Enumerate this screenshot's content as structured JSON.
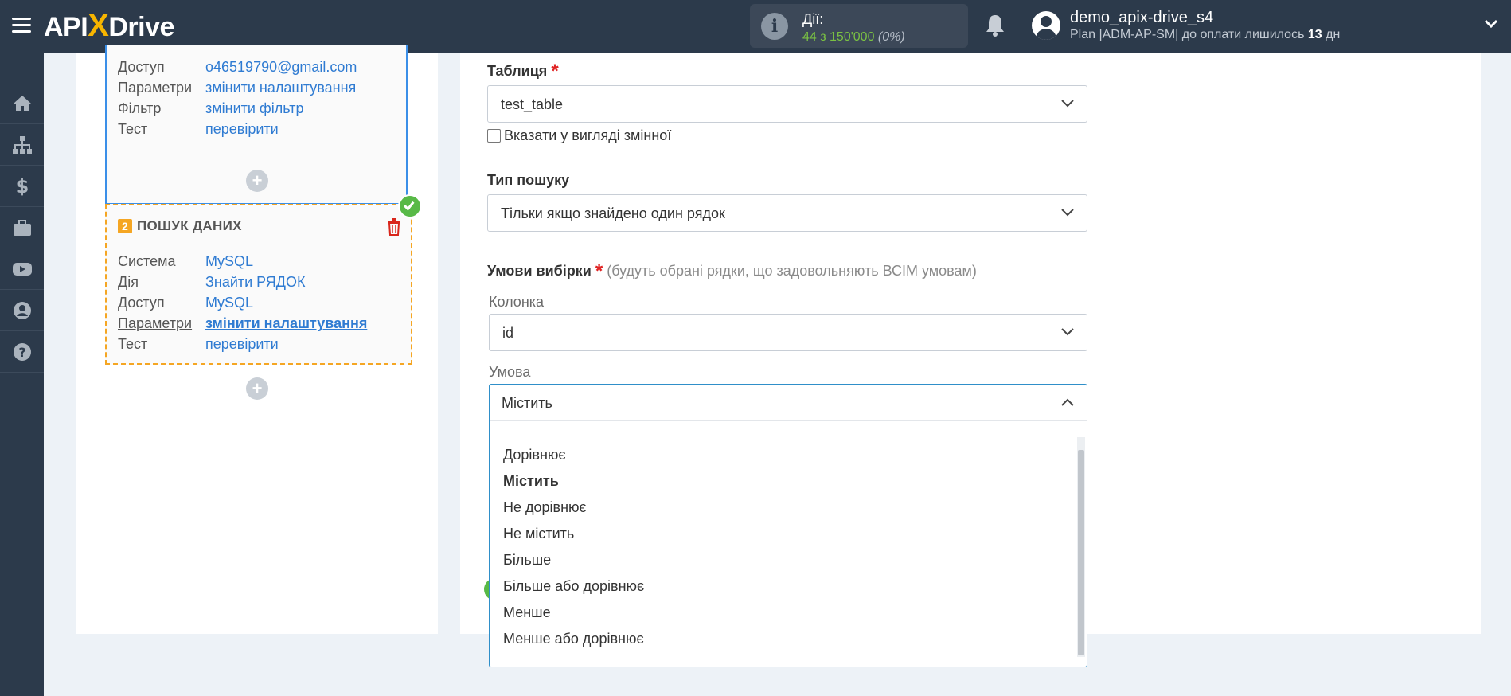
{
  "topbar": {
    "logo_pre": "API",
    "logo_x": "X",
    "logo_post": "Drive",
    "actions_label": "Дії:",
    "actions_value": "44 з 150'000",
    "actions_percent": "(0%)",
    "user_name": "demo_apix-drive_s4",
    "plan_text": "Plan |ADM-AP-SM| до оплати лишилось",
    "plan_days": "13",
    "plan_unit": "дн"
  },
  "sidebar": {
    "items": [
      "home-icon",
      "sitemap-icon",
      "dollar-icon",
      "briefcase-icon",
      "youtube-icon",
      "user-icon",
      "help-icon"
    ]
  },
  "card1": {
    "rows": [
      {
        "key": "Доступ",
        "value": "o46519790@gmail.com"
      },
      {
        "key": "Параметри",
        "value": "змінити налаштування"
      },
      {
        "key": "Фільтр",
        "value": "змінити фільтр"
      },
      {
        "key": "Тест",
        "value": "перевірити"
      }
    ]
  },
  "card2": {
    "number": "2",
    "title": "ПОШУК ДАНИХ",
    "rows": [
      {
        "key": "Система",
        "value": "MySQL"
      },
      {
        "key": "Дія",
        "value": "Знайти РЯДОК"
      },
      {
        "key": "Доступ",
        "value": "MySQL"
      },
      {
        "key": "Параметри",
        "value": "змінити налаштування"
      },
      {
        "key": "Тест",
        "value": "перевірити"
      }
    ]
  },
  "form": {
    "table_label": "Таблиця",
    "required_mark": "*",
    "table_value": "test_table",
    "as_variable_label": "Вказати у вигляді змінної",
    "search_type_label": "Тип пошуку",
    "search_type_value": "Тільки якщо знайдено один рядок",
    "conditions_label": "Умови вибірки",
    "conditions_hint": "(будуть обрані рядки, що задовольняють ВСІМ умовам)",
    "column_label": "Колонка",
    "column_value": "id",
    "condition_label": "Умова",
    "condition_value": "Містить"
  },
  "dropdown": {
    "options": [
      "Дорівнює",
      "Містить",
      "Не дорівнює",
      "Не містить",
      "Більше",
      "Більше або дорівнює",
      "Менше",
      "Менше або дорівнює"
    ],
    "selected": "Містить"
  },
  "colors": {
    "topbar": "#2c3a4b",
    "link": "#2f7bd2",
    "accent_orange": "#f5a623",
    "accent_blue": "#3b8fe8",
    "success": "#58b947"
  }
}
